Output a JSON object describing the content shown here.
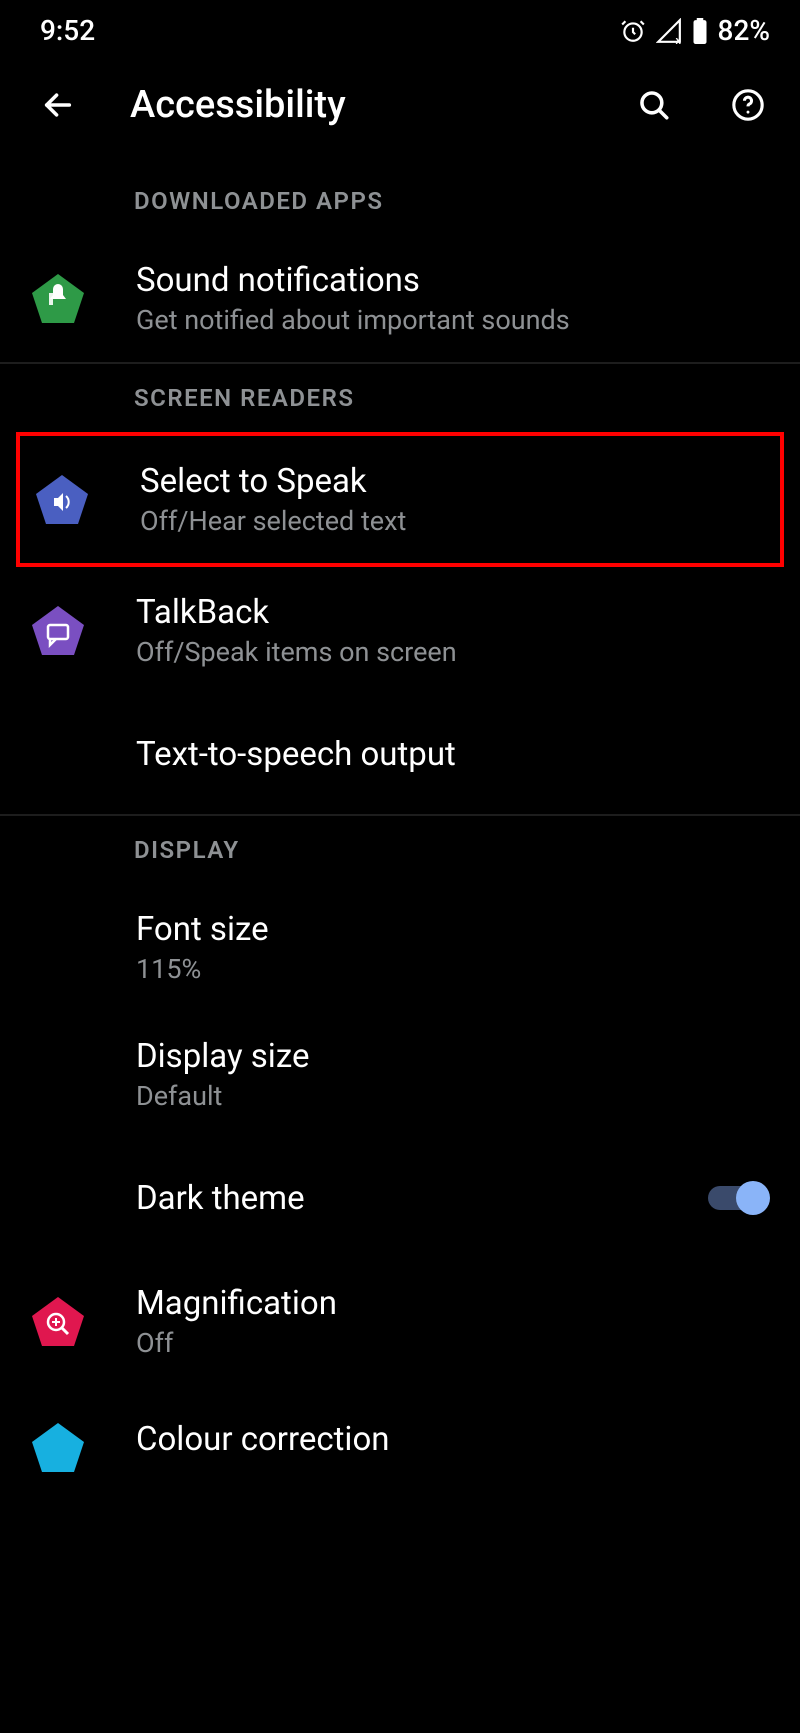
{
  "status": {
    "time": "9:52",
    "battery": "82%"
  },
  "header": {
    "title": "Accessibility"
  },
  "sections": {
    "downloaded": {
      "label": "DOWNLOADED APPS"
    },
    "screenReaders": {
      "label": "SCREEN READERS"
    },
    "display": {
      "label": "DISPLAY"
    }
  },
  "items": {
    "soundNotifications": {
      "title": "Sound notifications",
      "subtitle": "Get notified about important sounds"
    },
    "selectToSpeak": {
      "title": "Select to Speak",
      "subtitle": "Off/Hear selected text"
    },
    "talkback": {
      "title": "TalkBack",
      "subtitle": "Off/Speak items on screen"
    },
    "tts": {
      "title": "Text-to-speech output"
    },
    "fontSize": {
      "title": "Font size",
      "subtitle": "115%"
    },
    "displaySize": {
      "title": "Display size",
      "subtitle": "Default"
    },
    "darkTheme": {
      "title": "Dark theme"
    },
    "magnification": {
      "title": "Magnification",
      "subtitle": "Off"
    },
    "colourCorrection": {
      "title": "Colour correction"
    }
  }
}
